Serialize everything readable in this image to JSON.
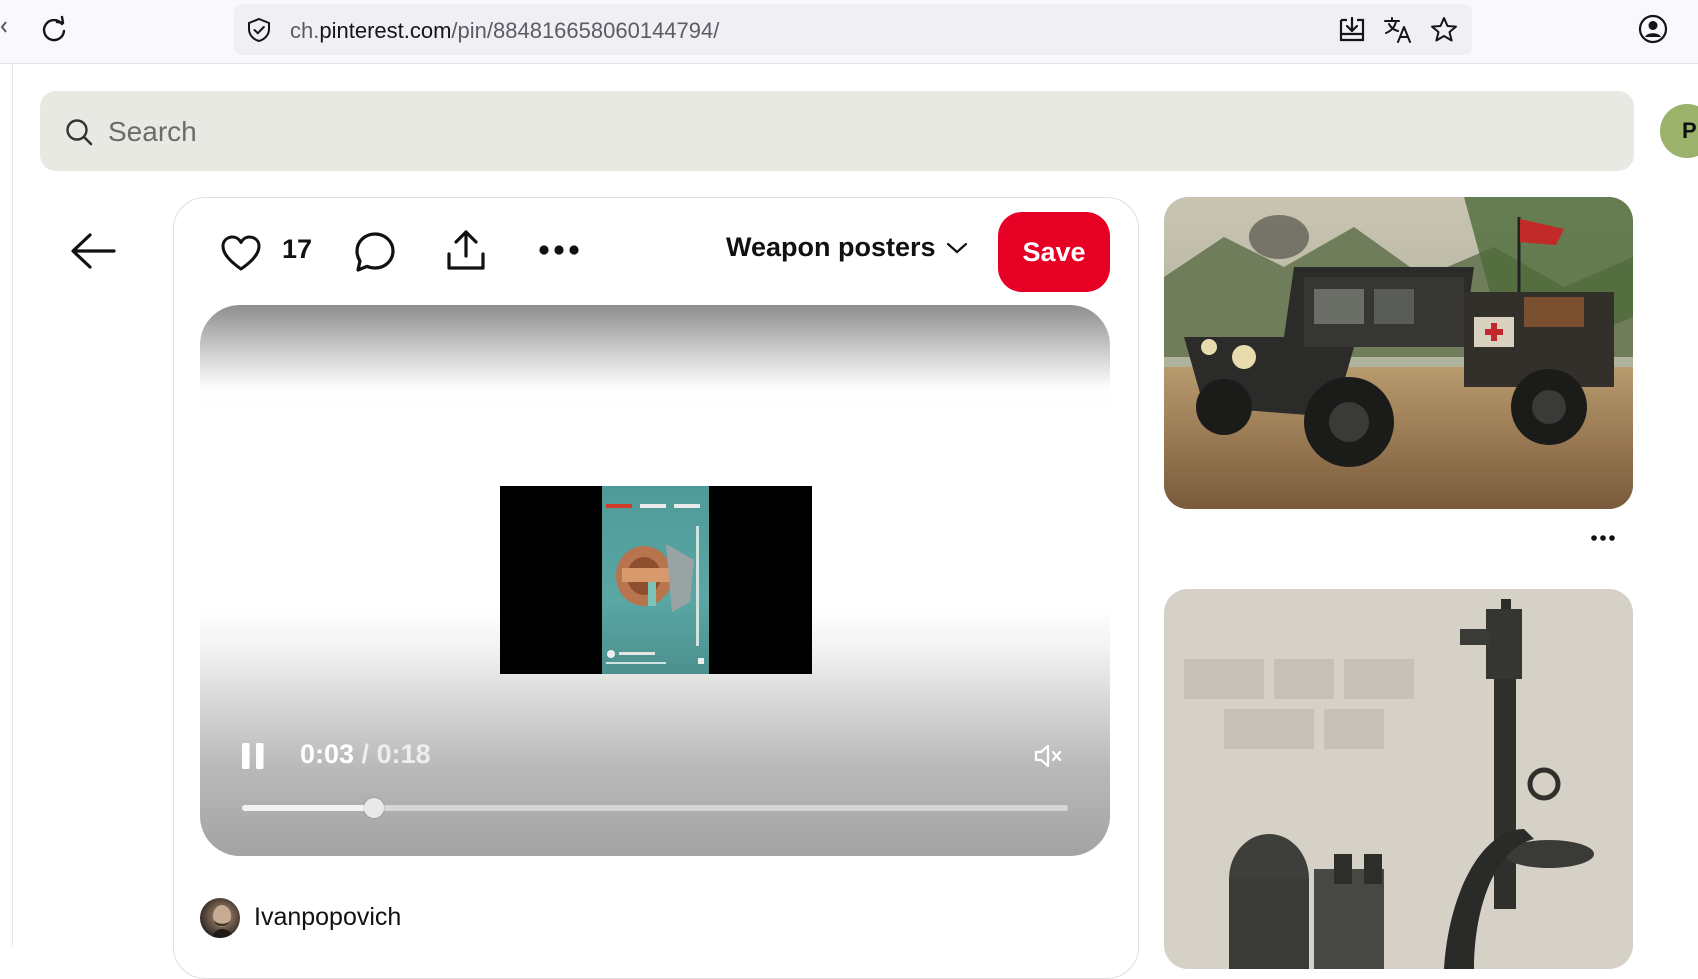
{
  "browser": {
    "url_prefix": "ch.",
    "url_domain": "pinterest.com",
    "url_path": "/pin/884816658060144794/"
  },
  "search": {
    "placeholder": "Search"
  },
  "account": {
    "initial": "P",
    "color": "#9bb26a"
  },
  "pin": {
    "like_count": "17",
    "board_name": "Weapon posters",
    "save_label": "Save",
    "save_color": "#e60023",
    "video": {
      "current_time": "0:03",
      "separator": " / ",
      "duration": "0:18",
      "progress_fraction": 0.16,
      "state": "playing",
      "muted": true
    },
    "author": {
      "name": "Ivanpopovich"
    }
  },
  "icons": {
    "reload": "reload-icon",
    "shield": "shield-icon",
    "download": "download-icon",
    "translate": "translate-icon",
    "bookmark": "star-icon",
    "account": "account-icon",
    "search": "search-icon",
    "back": "arrow-left-icon",
    "like": "heart-icon",
    "comment": "comment-icon",
    "share": "share-icon",
    "more": "more-dots-icon",
    "chevron": "chevron-down-icon",
    "pause": "pause-icon",
    "mute": "mute-icon"
  }
}
